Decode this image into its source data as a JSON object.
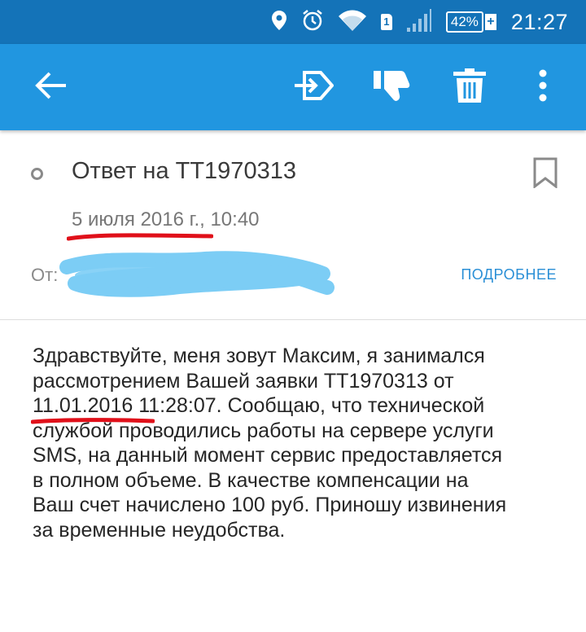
{
  "status_bar": {
    "time": "21:27",
    "battery_percent": "42%",
    "battery_plus": "+",
    "sim_slot": "1",
    "icons": [
      "location-icon",
      "alarm-icon",
      "wifi-icon",
      "sim-icon",
      "signal-icon",
      "battery-icon"
    ]
  },
  "toolbar": {
    "actions": [
      "back-arrow-icon",
      "move-to-folder-icon",
      "spam-thumbs-down-icon",
      "delete-trash-icon",
      "more-vertical-icon"
    ]
  },
  "message": {
    "subject": "Ответ на ТТ1970313",
    "date": "5 июля 2016 г., 10:40",
    "from_label": "От:",
    "details_link": "ПОДРОБНЕЕ",
    "body_lines": [
      "Здравствуйте, меня зовут Максим, я занимался",
      "рассмотрением Вашей заявки ТТ1970313 от",
      "11.01.2016 11:28:07. Сообщаю, что технической",
      "службой проводились работы на сервере услуги",
      "SMS, на данный момент сервис предоставляется",
      "в полном объеме. В качестве компенсации на",
      "Ваш счет начислено 100 руб. Приношу извинения",
      "за временные неудобства."
    ]
  },
  "colors": {
    "status_bar": "#1473b8",
    "app_bar": "#2196e0",
    "link": "#2a8fd6",
    "underline_annotation": "#e0101a",
    "scribble": "#7ccdf5"
  }
}
